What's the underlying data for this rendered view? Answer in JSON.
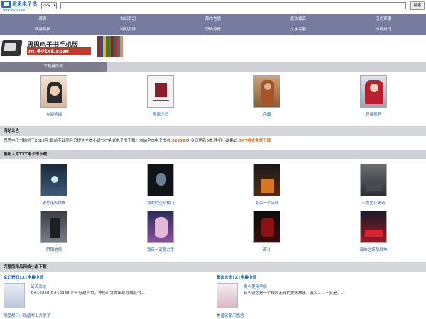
{
  "header": {
    "logo_text": "思思电子书",
    "logo_url": "www.44txt.com",
    "category_select": "小说",
    "search_placeholder": "",
    "search_button": "搜索"
  },
  "nav": {
    "items": [
      "首页",
      "玄幻奇幻",
      "都市言情",
      "武侠修真",
      "历史军事",
      "网游竞技",
      "科幻灵异",
      "恐怖惊奇",
      "文学名著",
      "小说排行"
    ]
  },
  "banner": {
    "title": "思思电子书手机版",
    "url": "m.44txt.com"
  },
  "download_rank": {
    "tab_label": "下载排行榜",
    "books": [
      {
        "title": "乡间艳福"
      },
      {
        "title": "邪家少妇"
      },
      {
        "title": "色魔"
      },
      {
        "title": "异世邪君"
      }
    ]
  },
  "announcement": {
    "title": "网站公告",
    "text_before": "思思电子书始创于2012年,目前专业而且只提供全本小说TXT格式电子书下载！本站全本电子书共:",
    "book_count": "52278",
    "text_mid1": "本,今日更新",
    "today_count": "0",
    "text_mid2": "本,手机小说格式:",
    "free_text": "TXT格式免费下载"
  },
  "latest": {
    "title": "最新入库TXT电子书下载",
    "books": [
      {
        "title": "破尽诸天世界"
      },
      {
        "title": "我的时空穿梭门"
      },
      {
        "title": "最后一个天师"
      },
      {
        "title": "人类生存史诗"
      },
      {
        "title": "阴阳地师"
      },
      {
        "title": "我有一双魔力手"
      },
      {
        "title": "奋斗"
      },
      {
        "title": "都市之妖孽战神"
      }
    ]
  },
  "complete": {
    "title": "完整版精品网络小说下载",
    "col1_title": "玄幻奇幻TXT全集小说",
    "col1_name": "幻天法域",
    "col1_desc": "&#12288;&#12288;少年穿越异世，神秘少女的出现导致会村...",
    "col1_link": "隔壁那只小凤凰考上大学了",
    "col2_title": "都市言情TXT全集小说",
    "col2_name": "男人使用手册",
    "col2_desc": "有人说这是一个爆笑无码的爱情故事。其实......不会是。...",
    "col2_link": "美善农家乐悠悠"
  }
}
